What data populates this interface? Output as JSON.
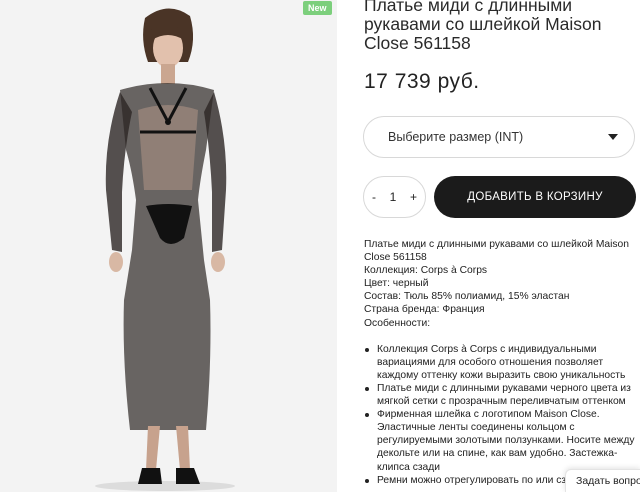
{
  "product": {
    "badge": "New",
    "title": "Платье миди с длинными рукавами со шлейкой Maison Close 561158",
    "price": "17 739 руб.",
    "size_placeholder": "Выберите размер (INT)",
    "quantity": "1",
    "qty_minus": "-",
    "qty_plus": "+",
    "add_to_cart": "ДОБАВИТЬ В КОРЗИНУ"
  },
  "description": {
    "lines": [
      "Платье миди с длинными рукавами со шлейкой Maison Close 561158",
      "Коллекция: Corps à Corps",
      "Цвет: черный",
      "Состав: Тюль 85% полиамид, 15% эластан",
      "Страна бренда: Франция",
      "Особенности:"
    ],
    "bullets": [
      "Коллекция Corps à Corps с индивидуальными вариациями для особого отношения позволяет каждому оттенку кожи выразить свою уникальность",
      "Платье миди с длинными рукавами черного цвета из мягкой сетки с прозрачным переливчатым оттенком",
      "Фирменная шлейка с логотипом Maison Close. Эластичные ленты соединены кольцом с регулируемыми золотыми ползунками. Носите между декольте или на спине, как вам удобно. Застежка-клипса сзади",
      "Ремни можно отрегулировать по или сзади"
    ]
  },
  "widget": {
    "ask_question": "Задать вопрос"
  },
  "colors": {
    "badge_bg": "#7ccf7c",
    "button_bg": "#1b1b1b",
    "photo_bg": "#f3f3f3"
  }
}
